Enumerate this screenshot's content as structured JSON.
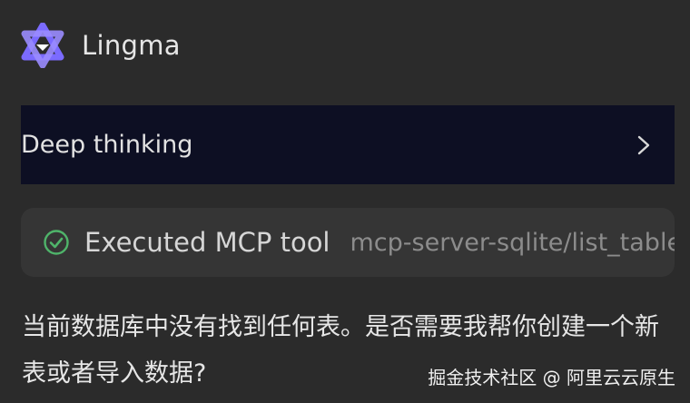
{
  "header": {
    "app_name": "Lingma",
    "logo_icon": "lingma-logo-icon"
  },
  "deep_thinking": {
    "label": "Deep thinking",
    "icon": "chevron-right-icon"
  },
  "tool_call": {
    "status": "Executed MCP tool",
    "tool_name": "mcp-server-sqlite/list_tables",
    "icon": "check-circle-icon"
  },
  "message": {
    "text": "当前数据库中没有找到任何表。是否需要我帮你创建一个新表或者导入数据?"
  },
  "watermark": {
    "text": "掘金技术社区 @ 阿里云云原生"
  },
  "colors": {
    "background": "#2b2b2b",
    "deep_thinking_bg": "#0d0f23",
    "tool_card_bg": "#353535",
    "success": "#4fb46a",
    "logo": "#7b6bff"
  }
}
